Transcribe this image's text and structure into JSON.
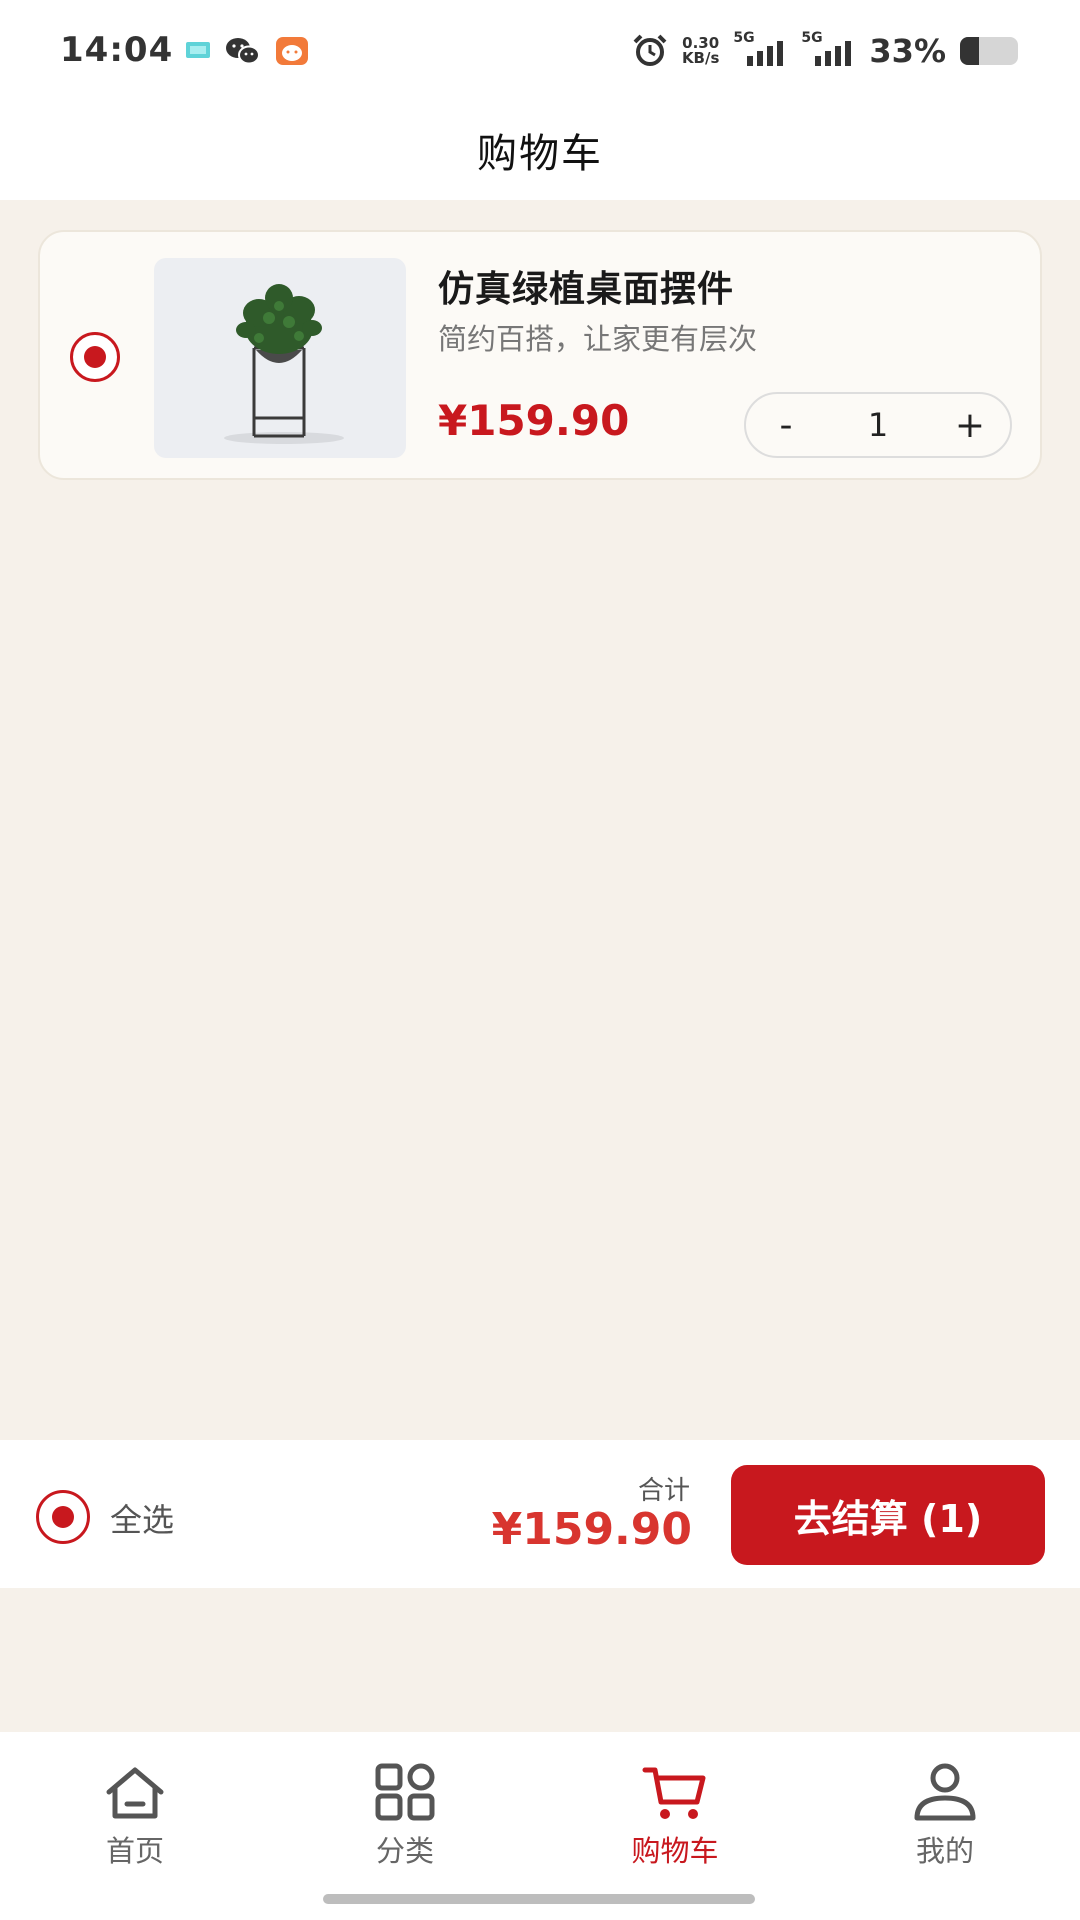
{
  "status_bar": {
    "time": "14:04",
    "net_speed_value": "0.30",
    "net_speed_unit": "KB/s",
    "signal_1": "5G",
    "signal_2": "5G",
    "battery_percent": "33%",
    "battery_level": 0.33
  },
  "header": {
    "title": "购物车"
  },
  "cart": {
    "items": [
      {
        "name": "仿真绿植桌面摆件",
        "description": "简约百搭，让家更有层次",
        "price": "¥159.90",
        "quantity": "1",
        "selected": true,
        "image_icon": "potted-plant-on-stand"
      }
    ],
    "stepper": {
      "minus": "-",
      "plus": "+"
    }
  },
  "checkout": {
    "select_all_label": "全选",
    "total_label": "合计",
    "total_amount": "¥159.90",
    "checkout_button": "去结算 (1)"
  },
  "bottom_nav": {
    "items": [
      {
        "label": "首页",
        "icon": "home-icon",
        "active": false
      },
      {
        "label": "分类",
        "icon": "grid-icon",
        "active": false
      },
      {
        "label": "购物车",
        "icon": "cart-icon",
        "active": true
      },
      {
        "label": "我的",
        "icon": "user-icon",
        "active": false
      }
    ]
  },
  "colors": {
    "accent": "#c8181e",
    "total_price": "#d8352f",
    "background": "#f6f1ea"
  }
}
